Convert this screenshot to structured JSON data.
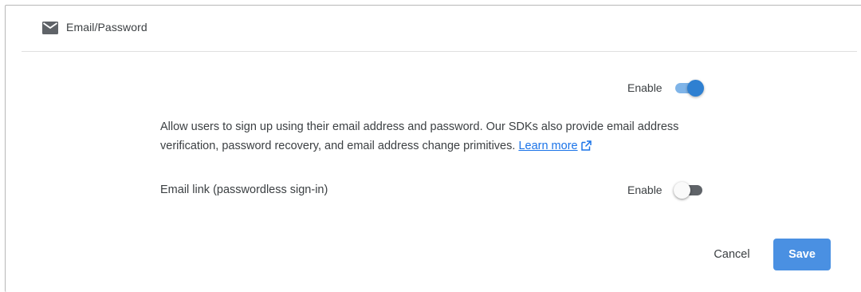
{
  "provider": {
    "title": "Email/Password",
    "icon": "envelope-icon"
  },
  "email_password": {
    "enable_label": "Enable",
    "enabled": true,
    "description": "Allow users to sign up using their email address and password. Our SDKs also provide email address verification, password recovery, and email address change primitives.",
    "learn_more_label": "Learn more",
    "learn_more_icon": "external-link-icon"
  },
  "email_link": {
    "label": "Email link (passwordless sign-in)",
    "enable_label": "Enable",
    "enabled": false
  },
  "actions": {
    "cancel_label": "Cancel",
    "save_label": "Save"
  },
  "colors": {
    "accent": "#2f80d1",
    "accent_track": "#7fb4e8",
    "save_button": "#4a90e2",
    "link": "#1a73e8"
  }
}
